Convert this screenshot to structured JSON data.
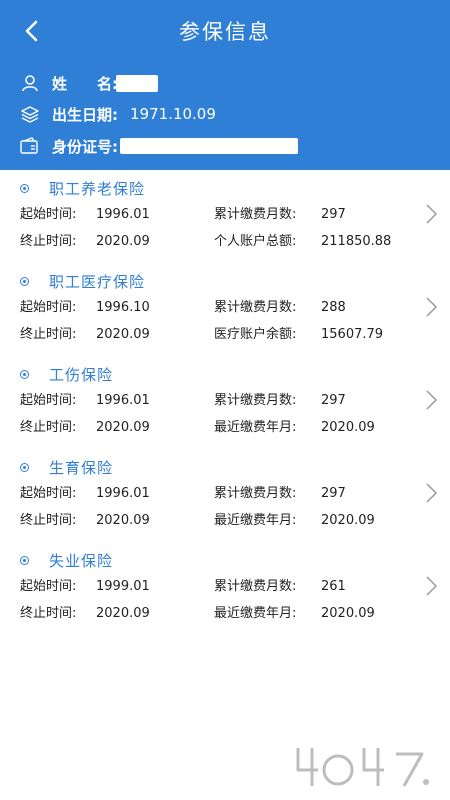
{
  "header": {
    "title": "参保信息",
    "name_label": "姓　　名:",
    "dob_label": "出生日期:",
    "dob_value": "1971.10.09",
    "id_label": "身份证号:"
  },
  "labels": {
    "start": "起始时间:",
    "end": "终止时间:",
    "months": "累计缴费月数:",
    "personal_total": "个人账户总额:",
    "medical_balance": "医疗账户余额:",
    "recent_month": "最近缴费年月:"
  },
  "sections": [
    {
      "title": "职工养老保险",
      "start": "1996.01",
      "end": "2020.09",
      "months": "297",
      "extra_label": "个人账户总额:",
      "extra_value": "211850.88"
    },
    {
      "title": "职工医疗保险",
      "start": "1996.10",
      "end": "2020.09",
      "months": "288",
      "extra_label": "医疗账户余额:",
      "extra_value": "15607.79"
    },
    {
      "title": "工伤保险",
      "start": "1996.01",
      "end": "2020.09",
      "months": "297",
      "extra_label": "最近缴费年月:",
      "extra_value": "2020.09"
    },
    {
      "title": "生育保险",
      "start": "1996.01",
      "end": "2020.09",
      "months": "297",
      "extra_label": "最近缴费年月:",
      "extra_value": "2020.09"
    },
    {
      "title": "失业保险",
      "start": "1999.01",
      "end": "2020.09",
      "months": "261",
      "extra_label": "最近缴费年月:",
      "extra_value": "2020.09"
    }
  ],
  "colors": {
    "accent": "#2f7fd6",
    "text": "#222222"
  },
  "icons": {
    "back": "chevron-left-icon",
    "name": "user-icon",
    "dob": "layers-icon",
    "id": "id-card-icon",
    "row": "chevron-right-icon"
  }
}
